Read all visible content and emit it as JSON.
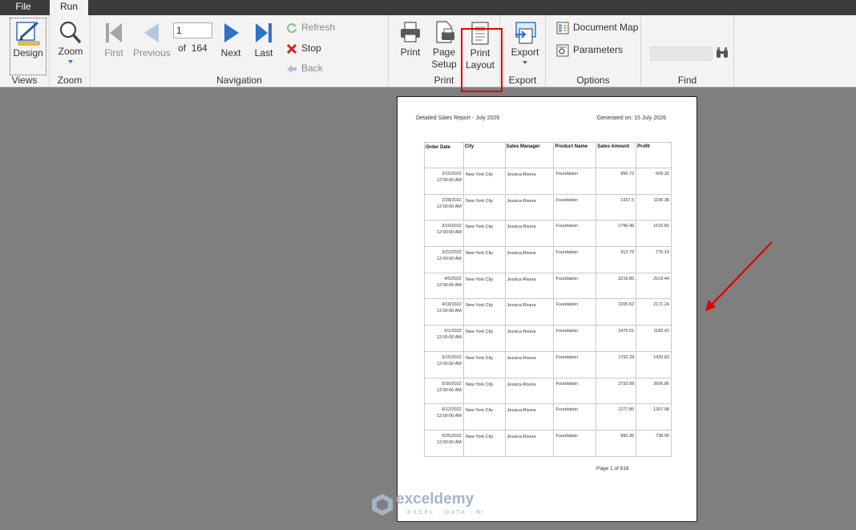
{
  "tabs": {
    "file": "File",
    "run": "Run"
  },
  "ribbon": {
    "views": {
      "group_label": "Views",
      "design_label": "Design"
    },
    "zoom": {
      "group_label": "Zoom",
      "zoom_label": "Zoom"
    },
    "navigation": {
      "group_label": "Navigation",
      "first": "First",
      "previous": "Previous",
      "next": "Next",
      "last": "Last",
      "page_value": "1",
      "of_label": "of",
      "total_pages": "164",
      "refresh": "Refresh",
      "stop": "Stop",
      "back": "Back"
    },
    "print": {
      "group_label": "Print",
      "print": "Print",
      "page_setup_line1": "Page",
      "page_setup_line2": "Setup",
      "print_layout_line1": "Print",
      "print_layout_line2": "Layout"
    },
    "export": {
      "group_label": "Export",
      "export": "Export"
    },
    "options": {
      "group_label": "Options",
      "document_map": "Document Map",
      "parameters": "Parameters"
    },
    "find": {
      "group_label": "Find",
      "value": ""
    }
  },
  "report": {
    "title": "Detailed Sales Report - July 2026",
    "generated": "Generated on: 15 July 2026",
    "columns": [
      "Order Date",
      "City",
      "Sales Manager",
      "Product Name",
      "Sales Amount",
      "Profit"
    ],
    "rows": [
      {
        "date": "2/15/2022",
        "time": "12:00:00 AM",
        "city": "New York City",
        "manager": "Jessica Rivera",
        "product": "Foundation",
        "amount": "856.72",
        "profit": "609.32"
      },
      {
        "date": "2/28/2022",
        "time": "12:00:00 AM",
        "city": "New York City",
        "manager": "Jessica Rivera",
        "product": "Foundation",
        "amount": "1337.5",
        "profit": "1190.38"
      },
      {
        "date": "3/10/2022",
        "time": "12:00:00 AM",
        "city": "New York City",
        "manager": "Jessica Rivera",
        "product": "Foundation",
        "amount": "1796.46",
        "profit": "1616.81"
      },
      {
        "date": "3/22/2022",
        "time": "12:00:00 AM",
        "city": "New York City",
        "manager": "Jessica Rivera",
        "product": "Foundation",
        "amount": "913.76",
        "profit": "776.19"
      },
      {
        "date": "4/5/2022",
        "time": "12:00:00 AM",
        "city": "New York City",
        "manager": "Jessica Rivera",
        "product": "Foundation",
        "amount": "3216.85",
        "profit": "2619.44"
      },
      {
        "date": "4/18/2022",
        "time": "12:00:00 AM",
        "city": "New York City",
        "manager": "Jessica Rivera",
        "product": "Foundation",
        "amount": "2265.52",
        "profit": "2171.24"
      },
      {
        "date": "5/1/2022",
        "time": "12:00:00 AM",
        "city": "New York City",
        "manager": "Jessica Rivera",
        "product": "Foundation",
        "amount": "1476.01",
        "profit": "1182.41"
      },
      {
        "date": "5/15/2022",
        "time": "12:00:00 AM",
        "city": "New York City",
        "manager": "Jessica Rivera",
        "product": "Foundation",
        "amount": "1792.28",
        "profit": "1433.83"
      },
      {
        "date": "5/30/2022",
        "time": "12:00:00 AM",
        "city": "New York City",
        "manager": "Jessica Rivera",
        "product": "Foundation",
        "amount": "2793.08",
        "profit": "2606.86"
      },
      {
        "date": "6/12/2022",
        "time": "12:00:00 AM",
        "city": "New York City",
        "manager": "Jessica Rivera",
        "product": "Foundation",
        "amount": "1277.85",
        "profit": "1207.98"
      },
      {
        "date": "6/25/2022",
        "time": "12:00:00 AM",
        "city": "New York City",
        "manager": "Jessica Rivera",
        "product": "Foundation",
        "amount": "890.35",
        "profit": "738.99"
      }
    ],
    "footer": "Page 1 of 618"
  },
  "watermark": {
    "name": "exceldemy",
    "tagline": "EXCEL · DATA · BI"
  },
  "colors": {
    "highlight": "#e00000",
    "arrow": "#e00000",
    "nav_blue": "#2f73c2",
    "canvas": "#7f7f7f"
  },
  "icons": [
    "design-icon",
    "zoom-icon",
    "first-icon",
    "previous-icon",
    "next-icon",
    "last-icon",
    "refresh-icon",
    "stop-icon",
    "back-icon",
    "print-icon",
    "page-setup-icon",
    "print-layout-icon",
    "export-icon",
    "document-map-icon",
    "parameters-icon",
    "binoculars-icon"
  ]
}
